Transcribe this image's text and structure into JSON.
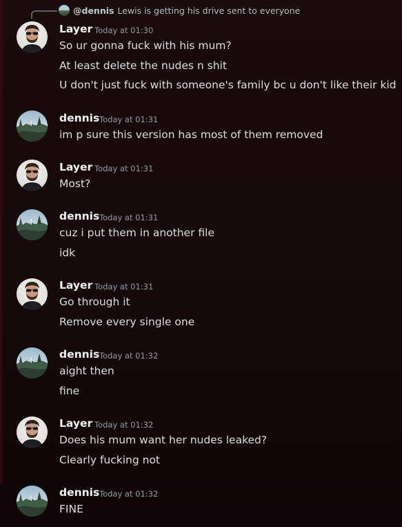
{
  "reply": {
    "author": "@dennis",
    "text": "Lewis is getting his drive sent to everyone"
  },
  "messages": [
    {
      "author": "Layer",
      "avatar_icon": "layer-avatar",
      "time": "Today at 01:30",
      "lines": [
        "So ur gonna fuck with his mum?",
        "At least delete the nudes n shit",
        "U don't just fuck with someone's family bc u don't like their kid"
      ]
    },
    {
      "author": "dennis",
      "avatar_icon": "dennis-avatar",
      "time": "Today at 01:31",
      "lines": [
        "im p sure this version has most of them removed"
      ]
    },
    {
      "author": "Layer",
      "avatar_icon": "layer-avatar",
      "time": "Today at 01:31",
      "lines": [
        "Most?"
      ]
    },
    {
      "author": "dennis",
      "avatar_icon": "dennis-avatar",
      "time": "Today at 01:31",
      "lines": [
        "cuz i put them in another file",
        "idk"
      ]
    },
    {
      "author": "Layer",
      "avatar_icon": "layer-avatar",
      "time": "Today at 01:31",
      "lines": [
        "Go through it",
        "Remove every single one"
      ]
    },
    {
      "author": "dennis",
      "avatar_icon": "dennis-avatar",
      "time": "Today at 01:32",
      "lines": [
        "aight then",
        "fine"
      ]
    },
    {
      "author": "Layer",
      "avatar_icon": "layer-avatar",
      "time": "Today at 01:32",
      "lines": [
        "Does his mum want her nudes leaked?",
        "Clearly fucking not"
      ]
    },
    {
      "author": "dennis",
      "avatar_icon": "dennis-avatar",
      "time": "Today at 01:32",
      "lines": [
        "FINE"
      ]
    }
  ]
}
